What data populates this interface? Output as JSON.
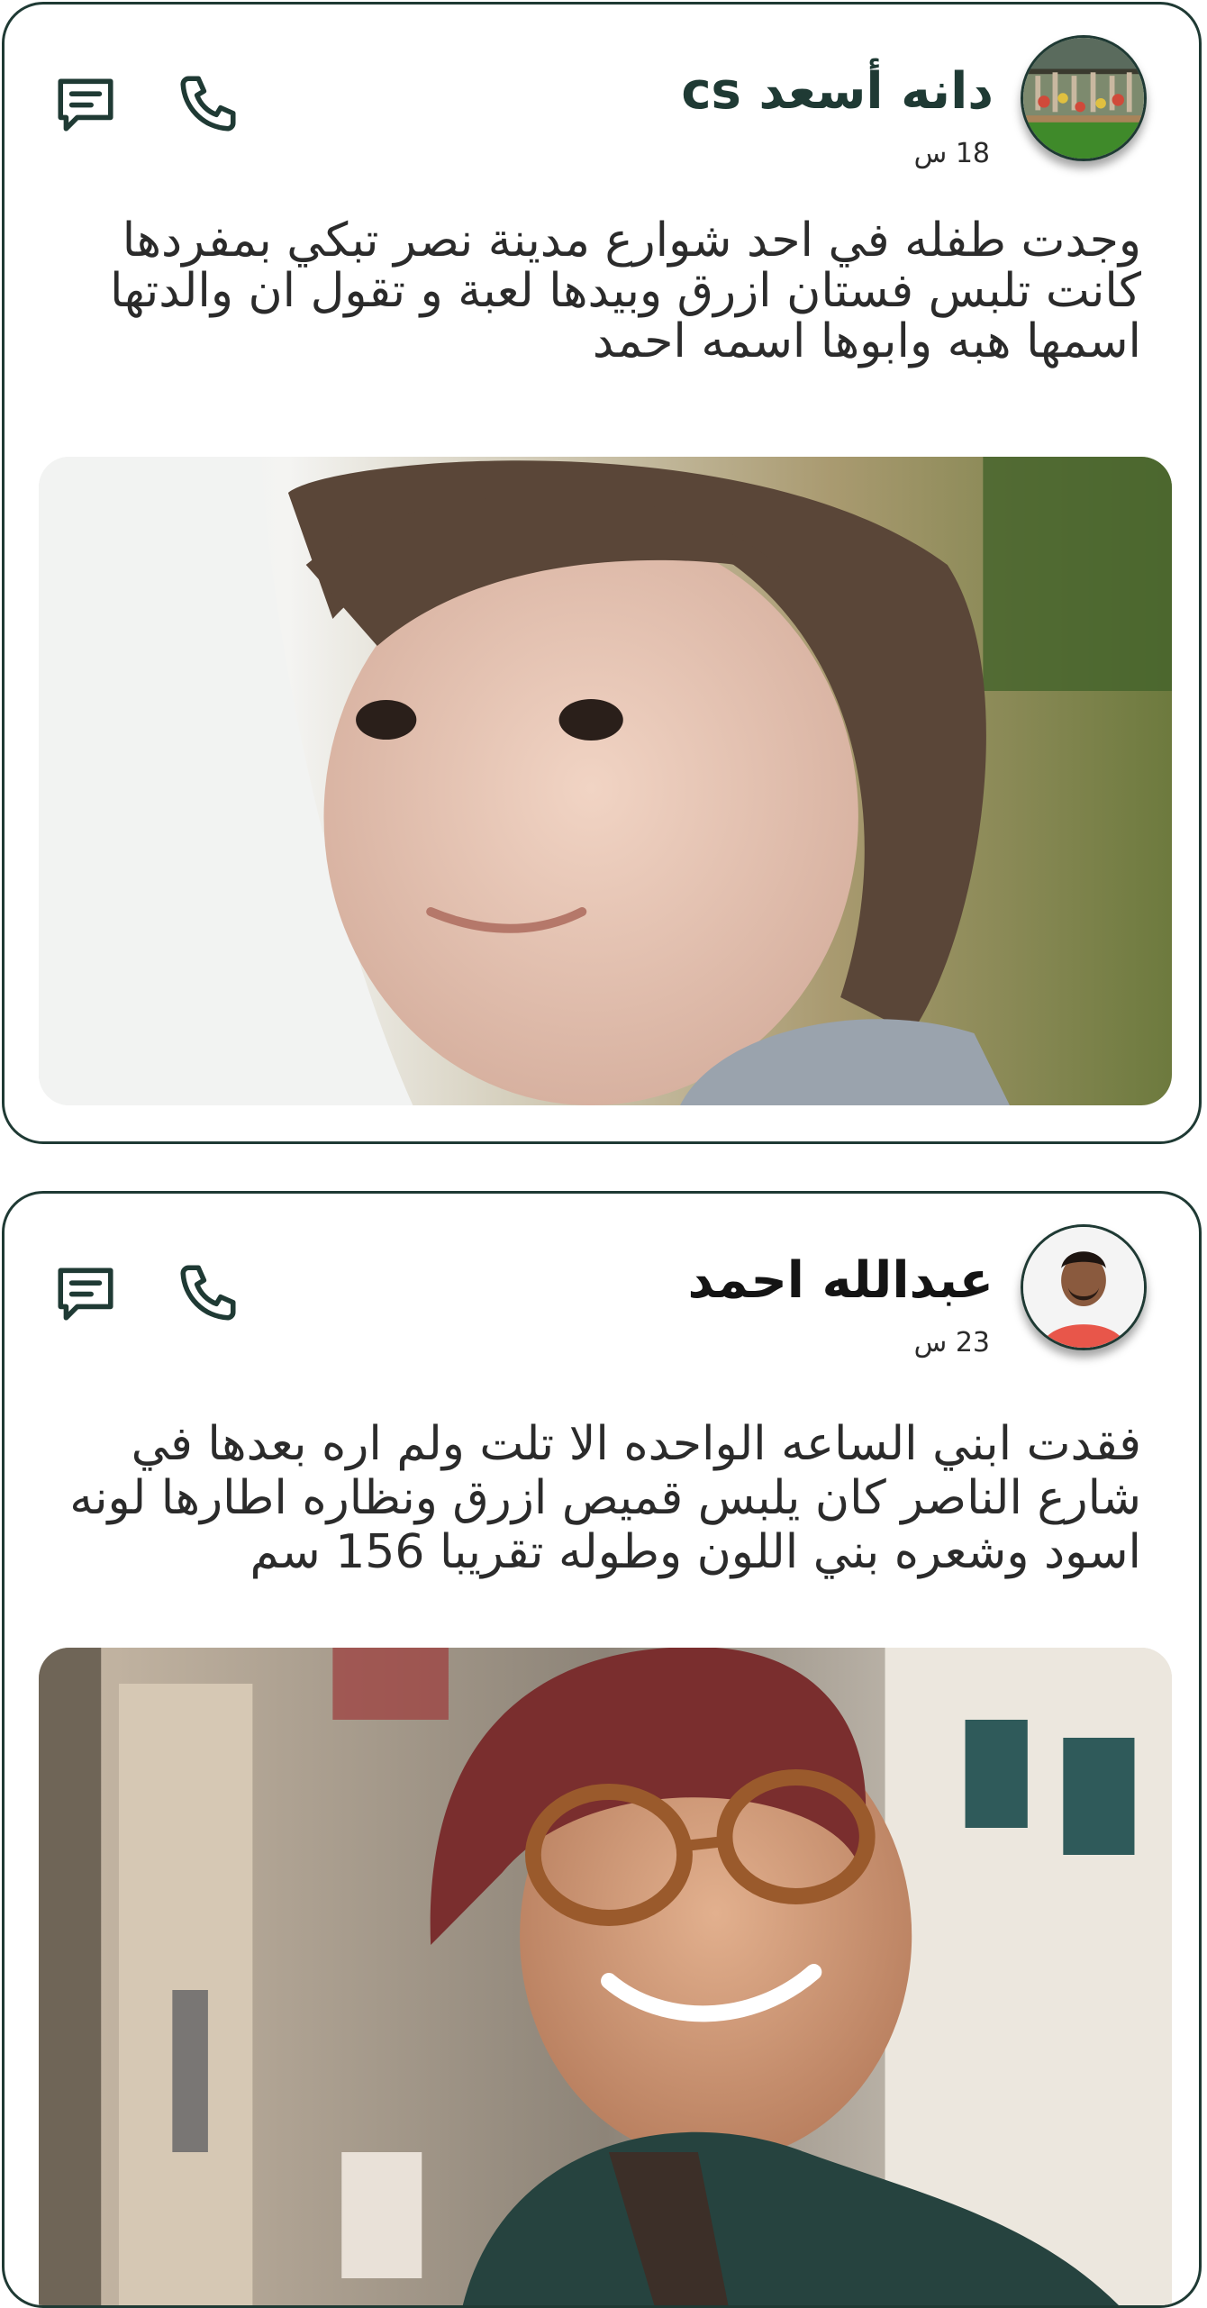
{
  "posts": [
    {
      "author": "دانه أسعد cs",
      "time": "18 س",
      "text": "وجدت طفله في احد شوارع مدينة نصر تبكي بمفردها كانت تلبس فستان ازرق وبيدها لعبة و تقول ان والدتها اسمها هبه وابوها اسمه احمد",
      "actions": {
        "comment_icon": "comment-icon",
        "call_icon": "phone-icon"
      }
    },
    {
      "author": "عبدالله احمد",
      "time": "23 س",
      "text": "فقدت ابني الساعه الواحده الا تلت ولم اره بعدها في شارع الناصر كان يلبس قميص ازرق ونظاره اطارها لونه اسود وشعره بني اللون وطوله تقريبا 156 سم",
      "actions": {
        "comment_icon": "comment-icon",
        "call_icon": "phone-icon"
      }
    }
  ],
  "colors": {
    "border": "#1f3a34",
    "text": "#2b2b2b",
    "name": "#1f3a34"
  }
}
